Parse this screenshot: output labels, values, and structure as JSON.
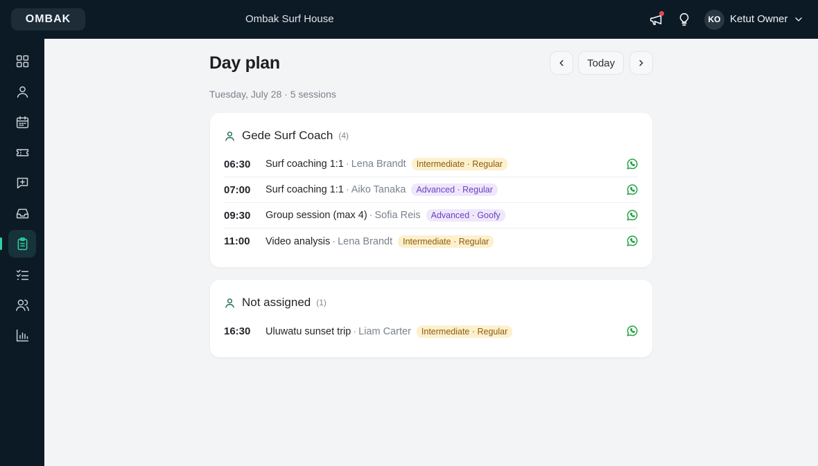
{
  "brand": {
    "logo": "OMBAK",
    "house_name": "Ombak Surf House"
  },
  "header": {
    "icons": [
      "megaphone-icon",
      "lightbulb-icon",
      "chevron-down-icon"
    ],
    "user": {
      "initials": "KO",
      "name": "Ketut Owner"
    },
    "notification_dot_color": "#e54a4a"
  },
  "sidebar": {
    "items": [
      {
        "name": "dashboard",
        "icon": "grid-icon"
      },
      {
        "name": "profile",
        "icon": "user-icon"
      },
      {
        "name": "calendar",
        "icon": "calendar-icon"
      },
      {
        "name": "tickets",
        "icon": "ticket-icon"
      },
      {
        "name": "messages",
        "icon": "message-plus-icon"
      },
      {
        "name": "inbox",
        "icon": "inbox-icon"
      },
      {
        "name": "day-plan",
        "icon": "clipboard-icon",
        "active": true
      },
      {
        "name": "checklist",
        "icon": "checklist-icon"
      },
      {
        "name": "team",
        "icon": "users-icon"
      },
      {
        "name": "reports",
        "icon": "bar-chart-icon"
      }
    ],
    "active_color": "#2dd4a0"
  },
  "page": {
    "title": "Day plan",
    "today_label": "Today",
    "prev_icon": "chevron-left-icon",
    "next_icon": "chevron-right-icon",
    "subtitle": "Tuesday, July 28 · 5 sessions"
  },
  "groups": [
    {
      "coach": "Gede Surf Coach",
      "count": "(4)",
      "sessions": [
        {
          "time": "06:30",
          "title": "Surf coaching 1:1",
          "client": "Lena Brandt",
          "tag": "Intermediate · Regular",
          "tag_style": "intermediate"
        },
        {
          "time": "07:00",
          "title": "Surf coaching 1:1",
          "client": "Aiko Tanaka",
          "tag": "Advanced · Regular",
          "tag_style": "advanced"
        },
        {
          "time": "09:30",
          "title": "Group session (max 4)",
          "client": "Sofia Reis",
          "tag": "Advanced · Goofy",
          "tag_style": "advanced"
        },
        {
          "time": "11:00",
          "title": "Video analysis",
          "client": "Lena Brandt",
          "tag": "Intermediate · Regular",
          "tag_style": "intermediate"
        }
      ]
    },
    {
      "coach": "Not assigned",
      "count": "(1)",
      "sessions": [
        {
          "time": "16:30",
          "title": "Uluwatu sunset trip",
          "client": "Liam Carter",
          "tag": "Intermediate · Regular",
          "tag_style": "intermediate"
        }
      ]
    }
  ],
  "colors": {
    "whatsapp": "#25a244",
    "intermediate_bg": "#fdf0cd",
    "advanced_bg": "#efe8fc"
  }
}
